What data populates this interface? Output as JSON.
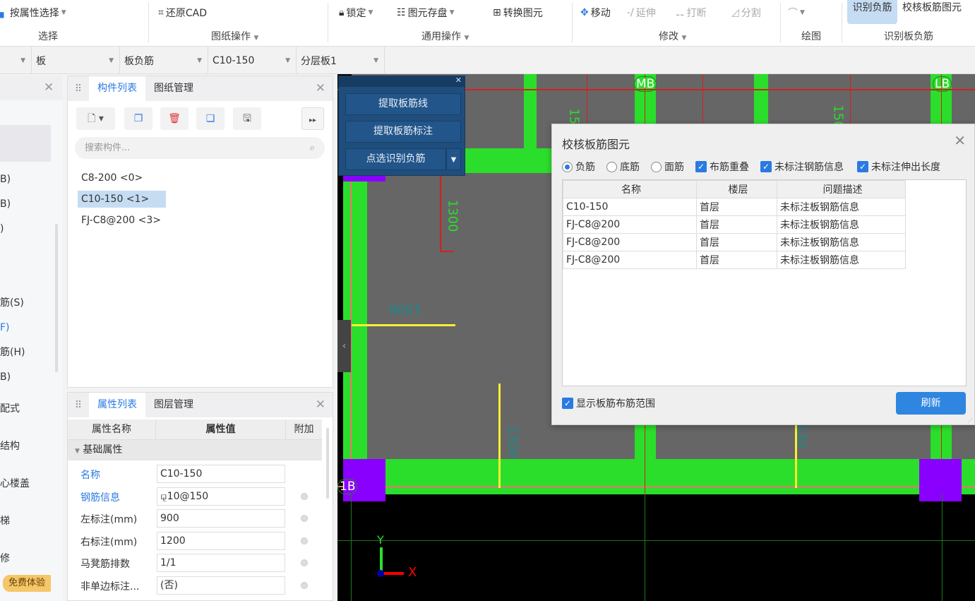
{
  "ribbon": {
    "select_by_attr": "按属性选择",
    "group_select": "选择",
    "restore_cad": "还原CAD",
    "group_drawing": "图纸操作",
    "lock": "锁定",
    "save_elements": "图元存盘",
    "convert_elements": "转换图元",
    "group_general": "通用操作",
    "move": "移动",
    "extend": "延伸",
    "break": "打断",
    "split": "分割",
    "group_modify": "修改",
    "group_draw": "绘图",
    "identify_neg": "识别负筋",
    "check_slab_rebar": "校核板筋图元",
    "group_identify": "识别板负筋"
  },
  "selectors": [
    "",
    "板",
    "板负筋",
    "C10-150",
    "分层板1"
  ],
  "left_nav": {
    "items": [
      "B)",
      "B)",
      ")",
      "筋(S)",
      "F)",
      "筋(H)",
      "B)",
      "配式",
      "结构",
      "心楼盖",
      "梯",
      "修"
    ],
    "trial_badge": "免费体验"
  },
  "component_panel": {
    "tabs": [
      "构件列表",
      "图纸管理"
    ],
    "search_placeholder": "搜索构件...",
    "items": [
      "C8-200 <0>",
      "C10-150 <1>",
      "FJ-C8@200 <3>"
    ],
    "selected": 1
  },
  "property_panel": {
    "tabs": [
      "属性列表",
      "图层管理"
    ],
    "headers": [
      "属性名称",
      "属性值",
      "附加"
    ],
    "group": "基础属性",
    "rows": [
      {
        "name": "名称",
        "value": "C10-150"
      },
      {
        "name": "钢筋信息",
        "value": "⚼10@150"
      },
      {
        "name": "左标注(mm)",
        "value": "900"
      },
      {
        "name": "右标注(mm)",
        "value": "1200"
      },
      {
        "name": "马凳筋排数",
        "value": "1/1"
      },
      {
        "name": "非单边标注...",
        "value": "(否)"
      }
    ]
  },
  "float_panel": {
    "btn1": "提取板筋线",
    "btn2": "提取板筋标注",
    "btn3": "点选识别负筋"
  },
  "canvas": {
    "labels": [
      "MB",
      "LB",
      "1B"
    ],
    "dims": [
      "150",
      "150",
      "1300",
      "1500",
      "1300",
      "130"
    ],
    "axis_x": "X",
    "axis_y": "Y"
  },
  "dialog": {
    "title": "校核板筋图元",
    "options": [
      {
        "label": "负筋",
        "type": "radio",
        "checked": true
      },
      {
        "label": "底筋",
        "type": "radio",
        "checked": false
      },
      {
        "label": "面筋",
        "type": "radio",
        "checked": false
      },
      {
        "label": "布筋重叠",
        "type": "check",
        "checked": true
      },
      {
        "label": "未标注钢筋信息",
        "type": "check",
        "checked": true
      },
      {
        "label": "未标注伸出长度",
        "type": "check",
        "checked": true
      }
    ],
    "headers": [
      "名称",
      "楼层",
      "问题描述"
    ],
    "rows": [
      [
        "C10-150",
        "首层",
        "未标注板钢筋信息"
      ],
      [
        "FJ-C8@200",
        "首层",
        "未标注板钢筋信息"
      ],
      [
        "FJ-C8@200",
        "首层",
        "未标注板钢筋信息"
      ],
      [
        "FJ-C8@200",
        "首层",
        "未标注板钢筋信息"
      ]
    ],
    "show_range": "显示板筋布筋范围",
    "refresh": "刷新"
  },
  "colors": {
    "accent": "#2a7ae2",
    "beam": "#2bde2b",
    "column": "#8a00ff",
    "slab": "#666666"
  }
}
